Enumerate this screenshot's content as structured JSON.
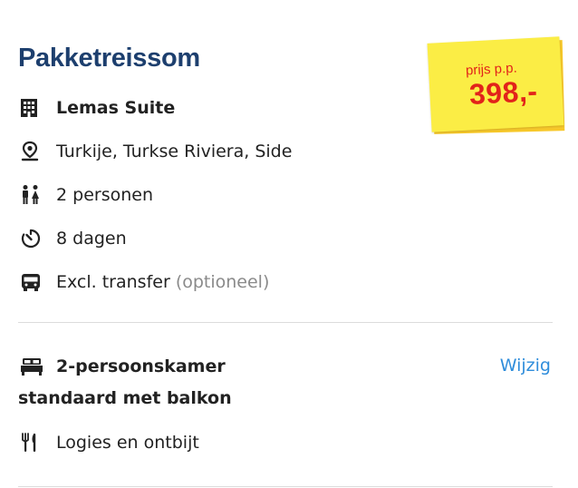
{
  "package": {
    "title": "Pakketreissom",
    "price_label": "prijs p.p.",
    "price_value": "398,-"
  },
  "details": [
    {
      "icon": "building-icon",
      "text": "Lemas Suite",
      "bold": true
    },
    {
      "icon": "location-pin-icon",
      "text": "Turkije, Turkse Riviera, Side"
    },
    {
      "icon": "persons-icon",
      "text": "2 personen"
    },
    {
      "icon": "timer-icon",
      "text": "8 dagen"
    },
    {
      "icon": "bus-icon",
      "text": "Excl. transfer",
      "suffix": "(optioneel)"
    }
  ],
  "room": {
    "icon": "bed-icon",
    "title": "2-persoonskamer",
    "subtitle": "standaard met balkon",
    "change_label": "Wijzig",
    "meal_icon": "fork-knife-icon",
    "meal": "Logies en ontbijt"
  },
  "colors": {
    "title": "#1d3f6e",
    "price": "#e2231a",
    "sticker": "#fbed45",
    "link": "#2f8ddb",
    "divider": "#dcdcdc"
  }
}
